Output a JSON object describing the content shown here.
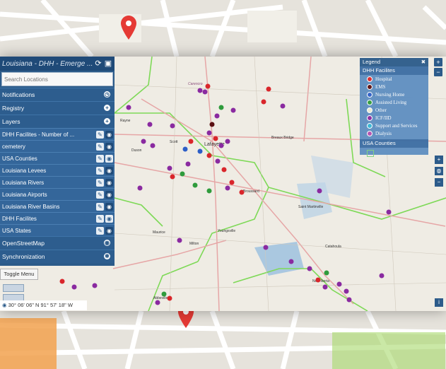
{
  "window": {
    "title": "Louisiana - DHH - Emerge ..."
  },
  "search": {
    "placeholder": "Search Locations"
  },
  "sections": {
    "notifications": "Notifications",
    "registry": "Registry",
    "layers": "Layers",
    "open_street_map": "OpenStreetMap",
    "synchronization": "Synchronization"
  },
  "layers": [
    {
      "label": "DHH Facilites - Number of ..."
    },
    {
      "label": "cemetery"
    },
    {
      "label": "USA Counties"
    },
    {
      "label": "Louisiana Levees"
    },
    {
      "label": "Louisiana Rivers"
    },
    {
      "label": "Louisiana Airports"
    },
    {
      "label": "Louisiana River Basins"
    },
    {
      "label": "DHH Facilites"
    },
    {
      "label": "USA States"
    }
  ],
  "toggle_menu": "Toggle Menu",
  "coordinates": "30° 06' 06\" N 91° 57' 18\" W",
  "legend": {
    "title": "Legend",
    "group": "DHH Facilites",
    "items": [
      {
        "label": "Hospital",
        "color": "#d9262b"
      },
      {
        "label": "EMS",
        "color": "#5a0f12"
      },
      {
        "label": "Nursing Home",
        "color": "#2d5ec7"
      },
      {
        "label": "Assisted Living",
        "color": "#2f9b3c"
      },
      {
        "label": "Other",
        "color": "#e9e9d0"
      },
      {
        "label": "ICF/IID",
        "color": "#8a2aa0"
      },
      {
        "label": "Support and Services",
        "color": "#35b6d6"
      },
      {
        "label": "Dialysis",
        "color": "#b14fb0"
      }
    ],
    "counties_group": "USA Counties",
    "counties_color": "#7dd17d"
  },
  "map_labels": {
    "carencro": "Carencro",
    "lafayette": "Lafayette",
    "youngsville": "Youngsville",
    "saint_martinville": "Saint Martinville",
    "new_iberia": "New Iberia",
    "abbeville": "Abbeville",
    "broussard": "Broussard",
    "scott": "Scott",
    "rayne": "Rayne",
    "duson": "Duson",
    "maurice": "Maurice",
    "milton": "Milton",
    "breaux_bridge": "Breaux Bridge",
    "catahoula": "Catahoula"
  },
  "colors": {
    "sidebar": "#2c5b8a",
    "county_lines": "#7ed957",
    "roads": "#e6a6a6"
  }
}
